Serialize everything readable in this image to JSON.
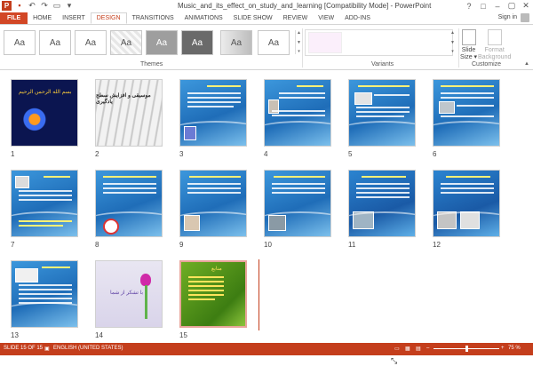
{
  "window": {
    "title": "Music_and_its_effect_on_study_and_learning [Compatibility Mode] - PowerPoint",
    "app_icon": "P",
    "controls": [
      "?",
      "□",
      "–",
      "▢",
      "✕"
    ]
  },
  "tabs": [
    "FILE",
    "HOME",
    "INSERT",
    "DESIGN",
    "TRANSITIONS",
    "ANIMATIONS",
    "SLIDE SHOW",
    "REVIEW",
    "VIEW",
    "ADD-INS"
  ],
  "active_tab": "DESIGN",
  "signin": "Sign in",
  "ribbon": {
    "themes": [
      "Aa",
      "Aa",
      "Aa",
      "Aa",
      "Aa",
      "Aa",
      "Aa",
      "Aa",
      "Aa"
    ],
    "groups": {
      "themes": "Themes",
      "variants": "Variants",
      "customize": "Customize"
    },
    "slide_size": {
      "line1": "Slide",
      "line2": "Size ▾"
    },
    "format_background": {
      "line1": "Format",
      "line2": "Background"
    }
  },
  "slides": [
    {
      "num": "1",
      "title": "بسم الله الرحمن الرحيم"
    },
    {
      "num": "2",
      "title": "موسیقی و افزایش سطح یادگیری"
    },
    {
      "num": "3"
    },
    {
      "num": "4"
    },
    {
      "num": "5"
    },
    {
      "num": "6"
    },
    {
      "num": "7"
    },
    {
      "num": "8"
    },
    {
      "num": "9"
    },
    {
      "num": "10"
    },
    {
      "num": "11"
    },
    {
      "num": "12"
    },
    {
      "num": "13"
    },
    {
      "num": "14",
      "title": "با تشکر از شما"
    },
    {
      "num": "15",
      "title": "منابع"
    }
  ],
  "status": {
    "slide": "SLIDE 15 OF 15",
    "language": "ENGLISH (UNITED STATES)",
    "zoom": "75 %",
    "zoom_fraction": 0.5
  },
  "colors": {
    "accent": "#c43e1c",
    "file_tab": "#d24726",
    "slide_blue": "#2a7fcf"
  }
}
